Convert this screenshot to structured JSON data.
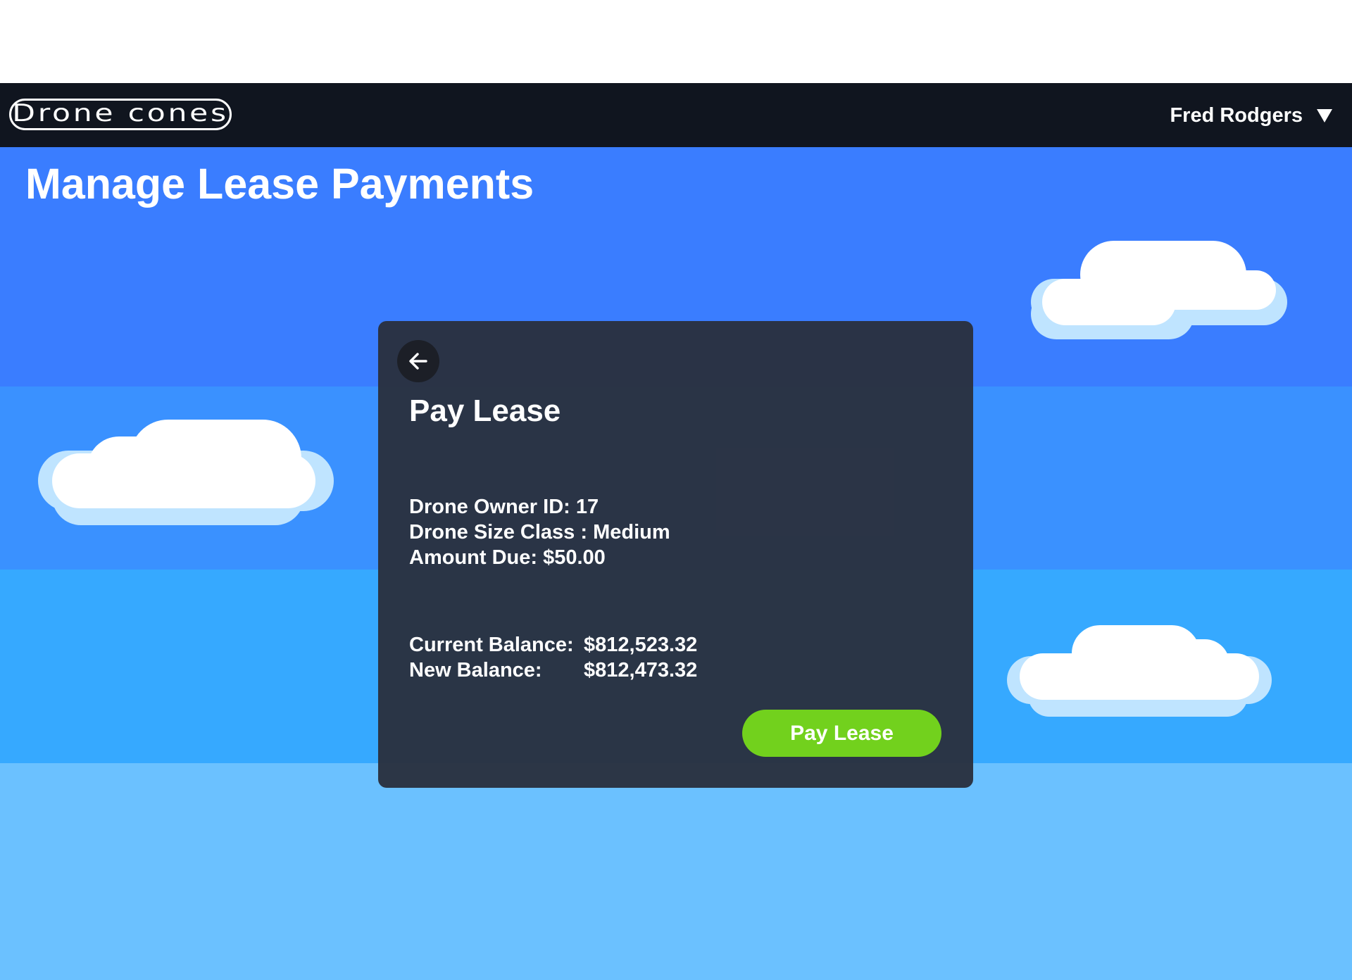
{
  "header": {
    "logo_text": "Drone cones",
    "user_name": "Fred Rodgers",
    "user_menu_icon": "caret-down-icon"
  },
  "page": {
    "title": "Manage Lease Payments"
  },
  "modal": {
    "back_icon": "arrow-left-icon",
    "title": "Pay Lease",
    "drone_owner_id": "Drone Owner ID: 17",
    "drone_size_class": "Drone Size Class : Medium",
    "amount_due": "Amount Due: $50.00",
    "current_balance_label": "Current Balance:",
    "current_balance_value": "$812,523.32",
    "new_balance_label": "New Balance:",
    "new_balance_value": "$812,473.32",
    "pay_button_label": "Pay Lease"
  },
  "colors": {
    "navbar": "#10151f",
    "sky_band_1": "#3a7dff",
    "sky_band_2": "#3a91ff",
    "sky_band_3": "#36a9ff",
    "sky_band_4": "#6bc1ff",
    "modal_background": "#2a303e",
    "pay_button": "#72d11d",
    "cloud_white": "#ffffff",
    "cloud_shadow": "#bfe4ff"
  }
}
